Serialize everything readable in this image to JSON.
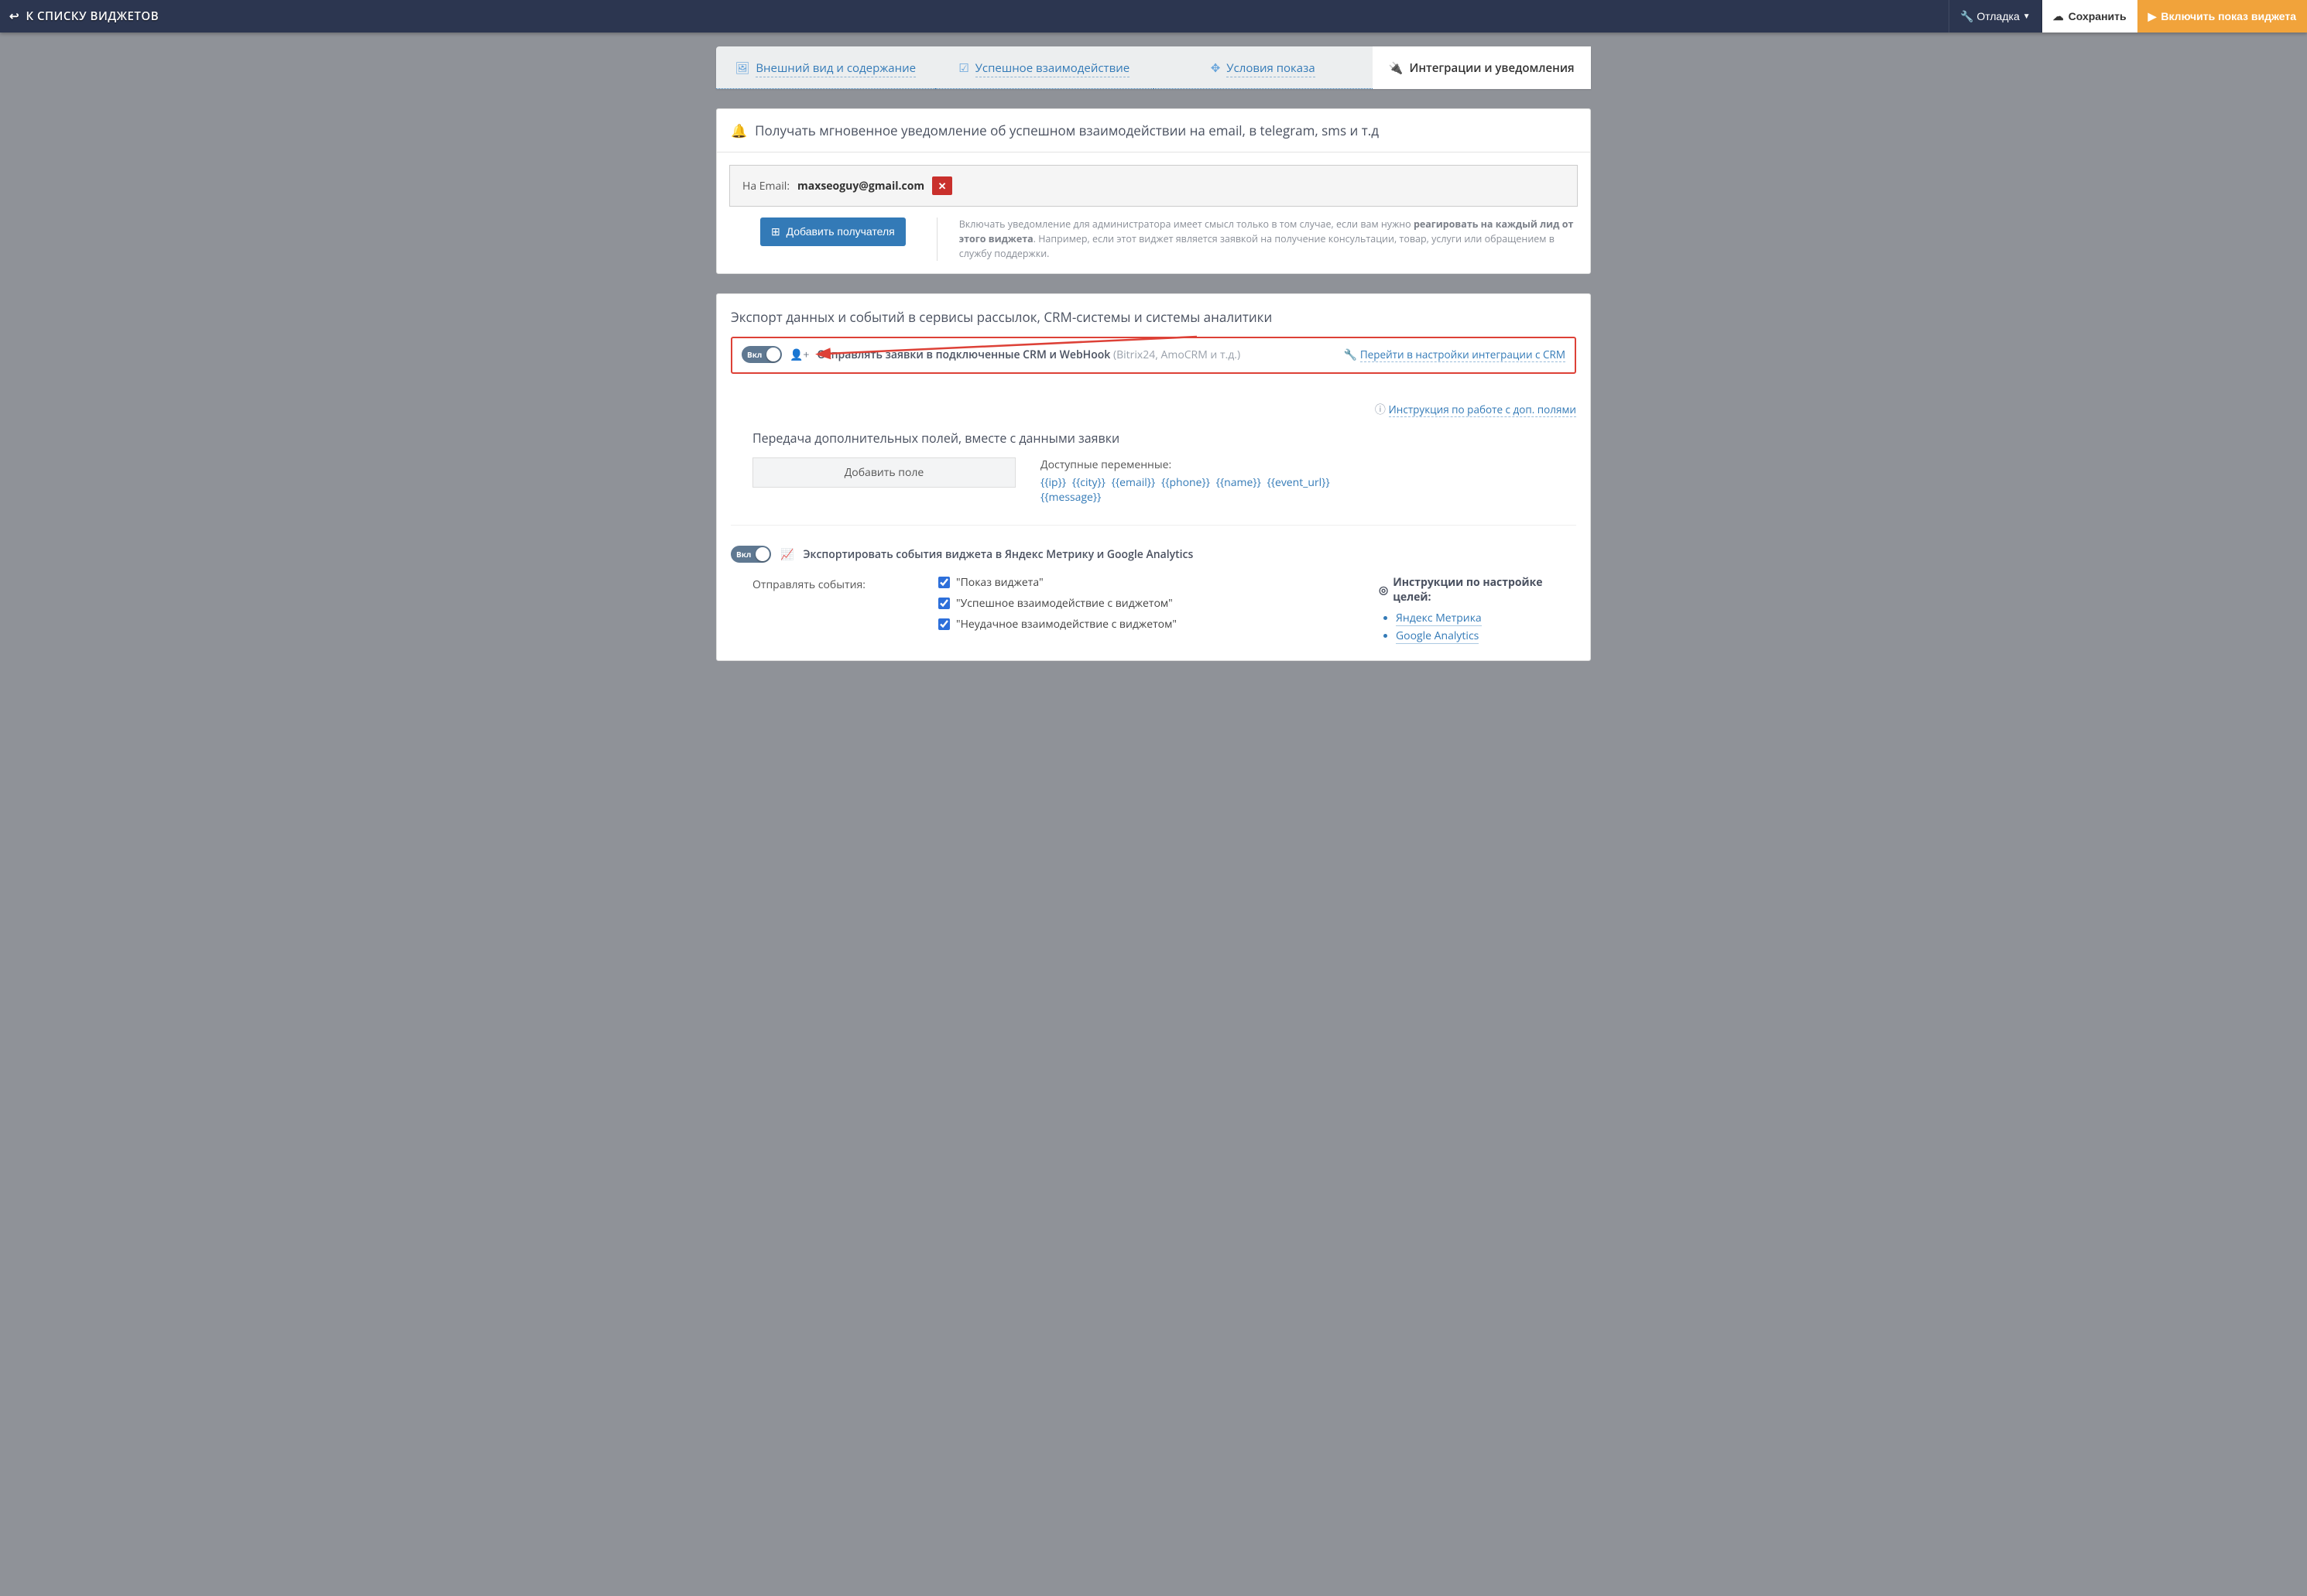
{
  "topbar": {
    "back": "К СПИСКУ ВИДЖЕТОВ",
    "debug": "Отладка",
    "save": "Сохранить",
    "enable": "Включить показ виджета"
  },
  "tabs": [
    {
      "label": "Внешний вид и содержание",
      "icon": "🖼"
    },
    {
      "label": "Успешное взаимодействие",
      "icon": "☑"
    },
    {
      "label": "Условия показа",
      "icon": "✥"
    },
    {
      "label": "Интеграции и уведомления",
      "icon": "🔌",
      "active": true
    }
  ],
  "notify": {
    "title": "Получать мгновенное уведомление об успешном взаимодействии на email, в telegram, sms и т.д",
    "email_prefix": "На Email:",
    "email_value": "maxseoguy@gmail.com",
    "add_recipient": "Добавить получателя",
    "help_a": "Включать уведомление для администратора имеет смысл только в том случае, если вам нужно ",
    "help_bold": "реагировать на каждый лид от этого виджета",
    "help_b": ". Например, если этот виджет является заявкой на получение консультации, товар, услуги или обращением в службу поддержки."
  },
  "export": {
    "title": "Экспорт данных и событий в сервисы рассылок, CRM-системы и системы аналитики",
    "crm": {
      "toggle": "Вкл",
      "label": "Отправлять заявки в подключенные CRM и WebHook",
      "note": "(Bitrix24, AmoCRM и т.д.)",
      "settings_link": "Перейти в настройки интеграции с CRM",
      "instr_link": "Инструкция по работе с доп. полями",
      "sub_title": "Передача дополнительных полей, вместе с данными заявки",
      "add_field": "Добавить поле",
      "vars_title": "Доступные переменные:",
      "vars": [
        "{{ip}}",
        "{{city}}",
        "{{email}}",
        "{{phone}}",
        "{{name}}",
        "{{event_url}}",
        "{{message}}"
      ]
    },
    "analytics": {
      "toggle": "Вкл",
      "label": "Экспортировать события виджета в Яндекс Метрику и Google Analytics",
      "send_label": "Отправлять события:",
      "events": [
        "\"Показ виджета\"",
        "\"Успешное взаимодействие с виджетом\"",
        "\"Неудачное взаимодействие с виджетом\""
      ],
      "instr_title": "Инструкции по настройке целей:",
      "instr_links": [
        "Яндекс Метрика",
        "Google Analytics"
      ]
    }
  }
}
